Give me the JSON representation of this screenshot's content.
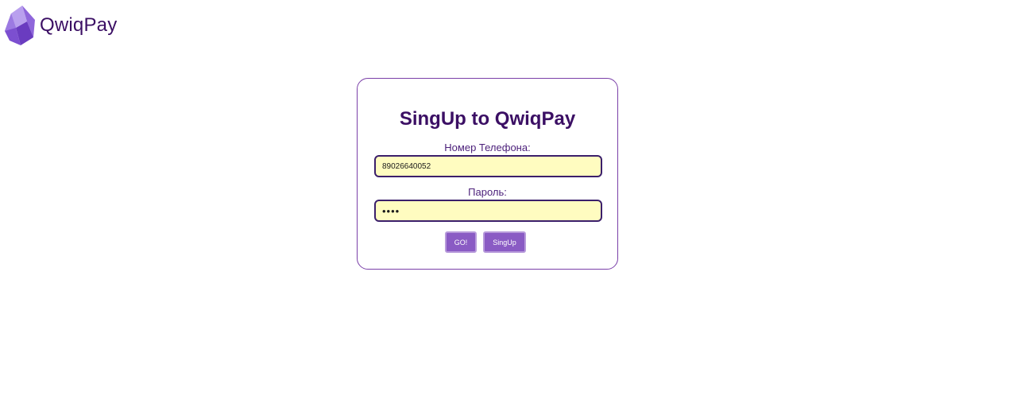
{
  "brand": {
    "name": "QwiqPay",
    "logo_icon": "crystal-logo-icon",
    "colors": {
      "logo_light": "#a98ae6",
      "logo_mid": "#8a5bd8",
      "logo_dark": "#6a3cc0",
      "text": "#3b0f64"
    }
  },
  "form": {
    "title": "SingUp to QwiqPay",
    "phone": {
      "label": "Номер Телефона:",
      "value": "89026640052"
    },
    "password": {
      "label": "Пароль:",
      "value": "1234"
    },
    "buttons": {
      "go_label": "GO!",
      "singup_label": "SingUp"
    }
  },
  "colors": {
    "accent": "#8a5bc4",
    "border": "#7a3fa8",
    "input_background": "#fffcc0",
    "input_border": "#3b1f6b",
    "title": "#3b0f64"
  }
}
